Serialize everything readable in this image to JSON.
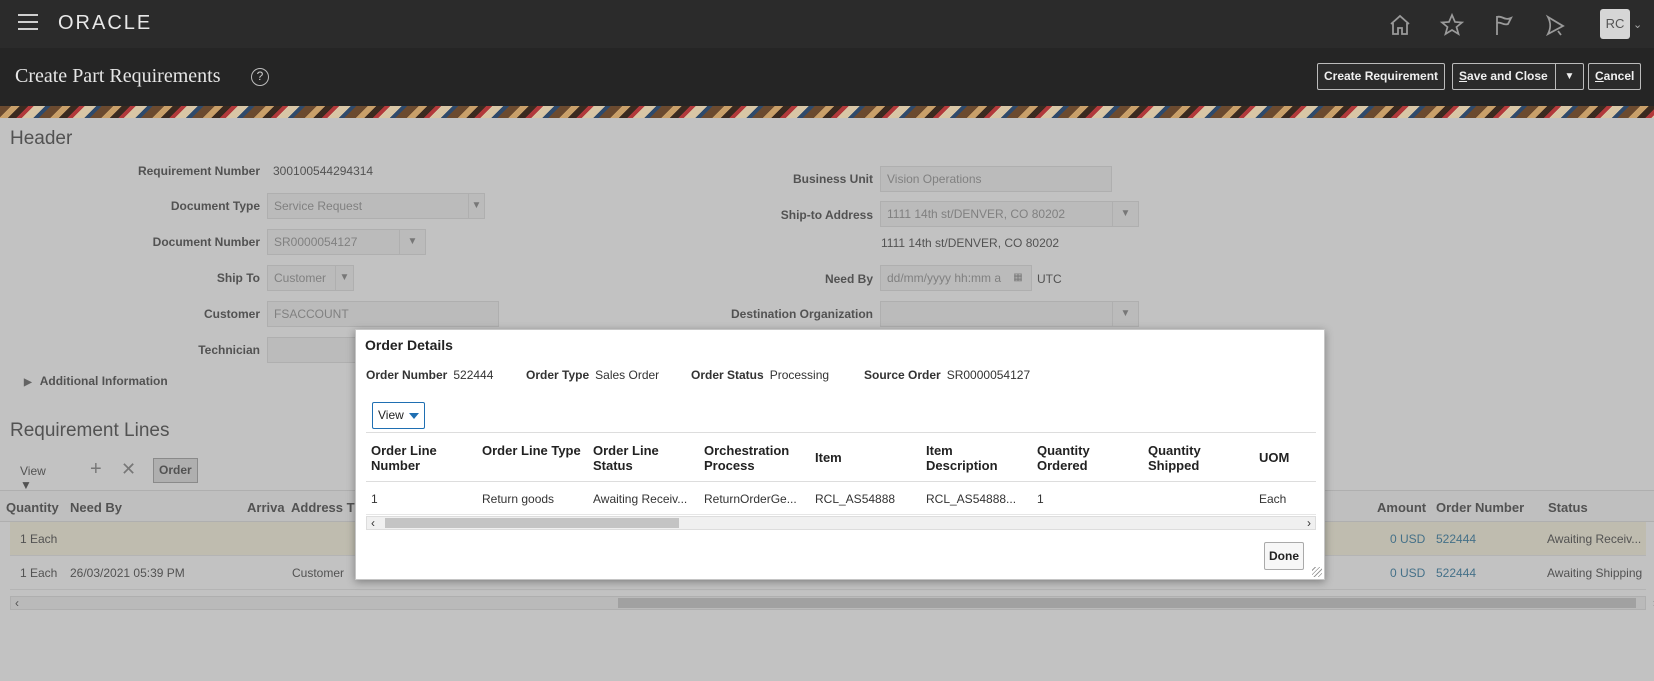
{
  "app": {
    "logo": "ORACLE",
    "avatar_initials": "RC"
  },
  "title_bar": {
    "title": "Create Part Requirements",
    "help": "?",
    "create_requirement": "Create Requirement",
    "save_and_close_prefix": "S",
    "save_and_close_rest": "ave and Close",
    "cancel_prefix": "C",
    "cancel_rest": "ancel"
  },
  "header": {
    "title": "Header",
    "requirement_number_label": "Requirement Number",
    "requirement_number": "300100544294314",
    "document_type_label": "Document Type",
    "document_type": "Service Request",
    "document_number_label": "Document Number",
    "document_number": "SR0000054127",
    "ship_to_label": "Ship To",
    "ship_to": "Customer",
    "customer_label": "Customer",
    "customer": "FSACCOUNT",
    "technician_label": "Technician",
    "business_unit_label": "Business Unit",
    "business_unit": "Vision Operations",
    "ship_to_address_label": "Ship-to Address",
    "ship_to_address": "1111 14th st/DENVER, CO 80202",
    "ship_to_address_text": "1111 14th st/DENVER, CO 80202",
    "need_by_label": "Need By",
    "need_by_placeholder": "dd/mm/yyyy hh:mm a",
    "timezone": "UTC",
    "destination_org_label": "Destination Organization",
    "additional_info": "Additional Information"
  },
  "requirement_lines": {
    "title": "Requirement Lines",
    "view": "View",
    "order_button": "Order",
    "columns": [
      "Quantity",
      "Need By",
      "Arriva",
      "Address T",
      "Amount",
      "Order Number",
      "Status"
    ],
    "rows": [
      {
        "qty": "1 Each",
        "need_by": "",
        "address": "",
        "amount": "0 USD",
        "order_number": "522444",
        "status": "Awaiting Receiv..."
      },
      {
        "qty": "1 Each",
        "need_by": "26/03/2021 05:39 PM",
        "address": "Customer",
        "amount": "0 USD",
        "order_number": "522444",
        "status": "Awaiting Shipping"
      }
    ]
  },
  "dialog": {
    "title": "Order Details",
    "order_number_label": "Order Number",
    "order_number": "522444",
    "order_type_label": "Order Type",
    "order_type": "Sales Order",
    "order_status_label": "Order Status",
    "order_status": "Processing",
    "source_order_label": "Source Order",
    "source_order": "SR0000054127",
    "view": "View",
    "columns": [
      "Order Line Number",
      "Order Line Type",
      "Order Line Status",
      "Orchestration Process",
      "Item",
      "Item Description",
      "Quantity Ordered",
      "Quantity Shipped",
      "UOM"
    ],
    "row": [
      "1",
      "Return goods",
      "Awaiting Receiv...",
      "ReturnOrderGe...",
      "RCL_AS54888",
      "RCL_AS54888...",
      "1",
      "",
      "Each"
    ],
    "done": "Done"
  }
}
